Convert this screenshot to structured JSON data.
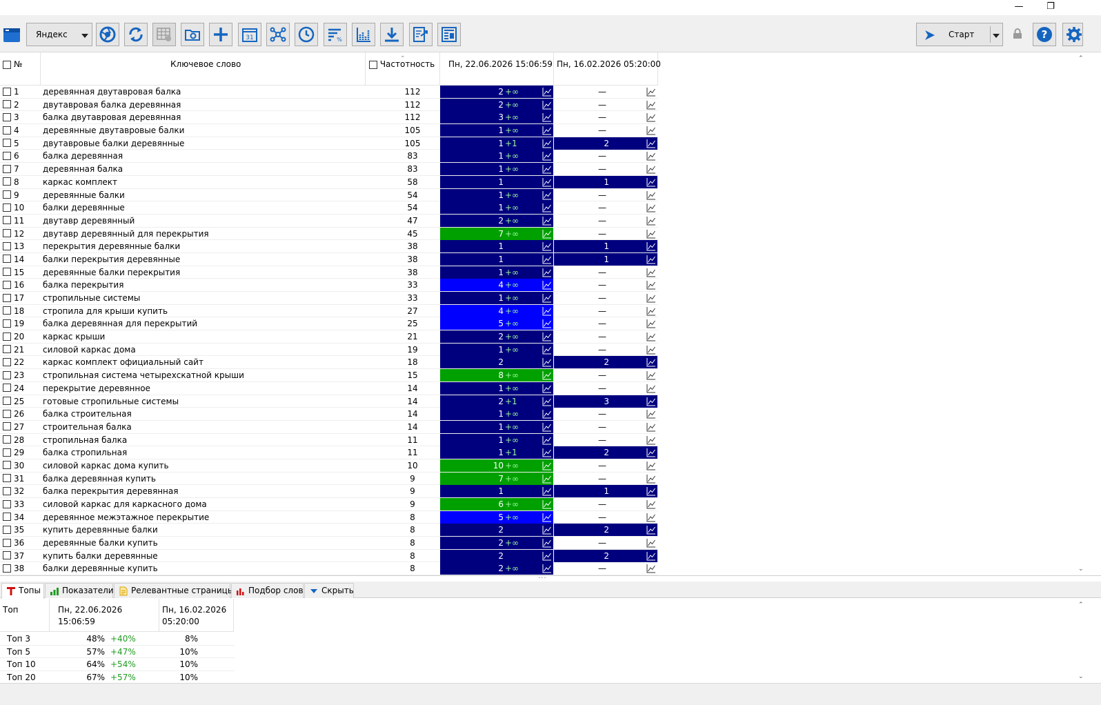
{
  "window": {
    "minimize": "—",
    "restore": "❐"
  },
  "toolbar": {
    "engine": "Яндекс",
    "start_label": "Старт",
    "calendar_day": "31",
    "icons": [
      "app-menu-icon",
      "browser-icon",
      "refresh-icon",
      "table-settings-icon",
      "folder-settings-icon",
      "add-icon",
      "calendar-icon",
      "network-icon",
      "clock-icon",
      "sort-percent-icon",
      "chart-bars-icon",
      "download-icon",
      "export-icon",
      "report-icon",
      "play-icon",
      "lock-icon",
      "help-icon",
      "settings-icon"
    ]
  },
  "grid": {
    "headers": {
      "no": "№",
      "keyword": "Ключевое слово",
      "frequency": "Частотность",
      "date1": "Пн, 22.06.2026 15:06:59",
      "date2": "Пн, 16.02.2026 05:20:00"
    },
    "no_value_mark": "—",
    "colors": {
      "dark": "#00007f",
      "blue": "#0000ff",
      "green": "#00a000",
      "delta": "#9cf89c"
    },
    "rows": [
      {
        "n": "1",
        "kw": "деревянная двутавровая балка",
        "f": "112",
        "p1": "2",
        "d1": "+∞",
        "c1": "dark",
        "p2": null
      },
      {
        "n": "2",
        "kw": "двутавровая балка деревянная",
        "f": "112",
        "p1": "2",
        "d1": "+∞",
        "c1": "dark",
        "p2": null
      },
      {
        "n": "3",
        "kw": "балка двутавровая деревянная",
        "f": "112",
        "p1": "3",
        "d1": "+∞",
        "c1": "dark",
        "p2": null
      },
      {
        "n": "4",
        "kw": "деревянные двутавровые балки",
        "f": "105",
        "p1": "1",
        "d1": "+∞",
        "c1": "dark",
        "p2": null
      },
      {
        "n": "5",
        "kw": "двутавровые балки деревянные",
        "f": "105",
        "p1": "1",
        "d1": "+1",
        "c1": "dark",
        "p2": "2"
      },
      {
        "n": "6",
        "kw": "балка деревянная",
        "f": "83",
        "p1": "1",
        "d1": "+∞",
        "c1": "dark",
        "p2": null
      },
      {
        "n": "7",
        "kw": "деревянная балка",
        "f": "83",
        "p1": "1",
        "d1": "+∞",
        "c1": "dark",
        "p2": null
      },
      {
        "n": "8",
        "kw": "каркас комплект",
        "f": "58",
        "p1": "1",
        "d1": "",
        "c1": "dark",
        "p2": "1"
      },
      {
        "n": "9",
        "kw": "деревянные балки",
        "f": "54",
        "p1": "1",
        "d1": "+∞",
        "c1": "dark",
        "p2": null
      },
      {
        "n": "10",
        "kw": "балки деревянные",
        "f": "54",
        "p1": "1",
        "d1": "+∞",
        "c1": "dark",
        "p2": null
      },
      {
        "n": "11",
        "kw": "двутавр деревянный",
        "f": "47",
        "p1": "2",
        "d1": "+∞",
        "c1": "dark",
        "p2": null
      },
      {
        "n": "12",
        "kw": "двутавр деревянный для перекрытия",
        "f": "45",
        "p1": "7",
        "d1": "+∞",
        "c1": "green",
        "p2": null
      },
      {
        "n": "13",
        "kw": "перекрытия деревянные балки",
        "f": "38",
        "p1": "1",
        "d1": "",
        "c1": "dark",
        "p2": "1"
      },
      {
        "n": "14",
        "kw": "балки перекрытия деревянные",
        "f": "38",
        "p1": "1",
        "d1": "",
        "c1": "dark",
        "p2": "1"
      },
      {
        "n": "15",
        "kw": "деревянные балки перекрытия",
        "f": "38",
        "p1": "1",
        "d1": "+∞",
        "c1": "dark",
        "p2": null
      },
      {
        "n": "16",
        "kw": "балка перекрытия",
        "f": "33",
        "p1": "4",
        "d1": "+∞",
        "c1": "blue",
        "p2": null
      },
      {
        "n": "17",
        "kw": "стропильные системы",
        "f": "33",
        "p1": "1",
        "d1": "+∞",
        "c1": "dark",
        "p2": null
      },
      {
        "n": "18",
        "kw": "стропила для крыши купить",
        "f": "27",
        "p1": "4",
        "d1": "+∞",
        "c1": "blue",
        "p2": null
      },
      {
        "n": "19",
        "kw": "балка деревянная для перекрытий",
        "f": "25",
        "p1": "5",
        "d1": "+∞",
        "c1": "blue",
        "p2": null
      },
      {
        "n": "20",
        "kw": "каркас крыши",
        "f": "21",
        "p1": "2",
        "d1": "+∞",
        "c1": "dark",
        "p2": null
      },
      {
        "n": "21",
        "kw": "силовой каркас дома",
        "f": "19",
        "p1": "1",
        "d1": "+∞",
        "c1": "dark",
        "p2": null
      },
      {
        "n": "22",
        "kw": "каркас комплект официальный сайт",
        "f": "18",
        "p1": "2",
        "d1": "",
        "c1": "dark",
        "p2": "2"
      },
      {
        "n": "23",
        "kw": "стропильная система четырехскатной крыши",
        "f": "15",
        "p1": "8",
        "d1": "+∞",
        "c1": "green",
        "p2": null
      },
      {
        "n": "24",
        "kw": "перекрытие деревянное",
        "f": "14",
        "p1": "1",
        "d1": "+∞",
        "c1": "dark",
        "p2": null
      },
      {
        "n": "25",
        "kw": "готовые стропильные системы",
        "f": "14",
        "p1": "2",
        "d1": "+1",
        "c1": "dark",
        "p2": "3"
      },
      {
        "n": "26",
        "kw": "балка строительная",
        "f": "14",
        "p1": "1",
        "d1": "+∞",
        "c1": "dark",
        "p2": null
      },
      {
        "n": "27",
        "kw": "строительная балка",
        "f": "14",
        "p1": "1",
        "d1": "+∞",
        "c1": "dark",
        "p2": null
      },
      {
        "n": "28",
        "kw": "стропильная балка",
        "f": "11",
        "p1": "1",
        "d1": "+∞",
        "c1": "dark",
        "p2": null
      },
      {
        "n": "29",
        "kw": "балка стропильная",
        "f": "11",
        "p1": "1",
        "d1": "+1",
        "c1": "dark",
        "p2": "2"
      },
      {
        "n": "30",
        "kw": "силовой каркас дома купить",
        "f": "10",
        "p1": "10",
        "d1": "+∞",
        "c1": "green",
        "p2": null
      },
      {
        "n": "31",
        "kw": "балка деревянная купить",
        "f": "9",
        "p1": "7",
        "d1": "+∞",
        "c1": "green",
        "p2": null
      },
      {
        "n": "32",
        "kw": "балка перекрытия деревянная",
        "f": "9",
        "p1": "1",
        "d1": "",
        "c1": "dark",
        "p2": "1"
      },
      {
        "n": "33",
        "kw": "силовой каркас для каркасного дома",
        "f": "9",
        "p1": "6",
        "d1": "+∞",
        "c1": "green",
        "p2": null
      },
      {
        "n": "34",
        "kw": "деревянное межэтажное перекрытие",
        "f": "8",
        "p1": "5",
        "d1": "+∞",
        "c1": "blue",
        "p2": null
      },
      {
        "n": "35",
        "kw": "купить деревянные балки",
        "f": "8",
        "p1": "2",
        "d1": "",
        "c1": "dark",
        "p2": "2"
      },
      {
        "n": "36",
        "kw": "деревянные балки купить",
        "f": "8",
        "p1": "2",
        "d1": "+∞",
        "c1": "dark",
        "p2": null
      },
      {
        "n": "37",
        "kw": "купить балки деревянные",
        "f": "8",
        "p1": "2",
        "d1": "",
        "c1": "dark",
        "p2": "2"
      },
      {
        "n": "38",
        "kw": "балки деревянные купить",
        "f": "8",
        "p1": "2",
        "d1": "+∞",
        "c1": "dark",
        "p2": null
      }
    ]
  },
  "tabs": [
    {
      "label": "Топы",
      "icon": "tops-icon",
      "active": true
    },
    {
      "label": "Показатели",
      "icon": "indicators-icon",
      "active": false
    },
    {
      "label": "Релевантные страницы",
      "icon": "pages-icon",
      "active": false
    },
    {
      "label": "Подбор слов",
      "icon": "word-selection-icon",
      "active": false
    },
    {
      "label": "Скрыть",
      "icon": "hide-icon",
      "active": false
    }
  ],
  "tops": {
    "header": {
      "label": "Топ",
      "date1": "Пн, 22.06.2026 15:06:59",
      "date2_line1": "Пн, 16.02.2026",
      "date2_line2": "05:20:00"
    },
    "rows": [
      {
        "label": "Топ 3",
        "v1": "48%",
        "d1": "+40%",
        "v2": "8%"
      },
      {
        "label": "Топ 5",
        "v1": "57%",
        "d1": "+47%",
        "v2": "10%"
      },
      {
        "label": "Топ 10",
        "v1": "64%",
        "d1": "+54%",
        "v2": "10%"
      },
      {
        "label": "Топ 20",
        "v1": "67%",
        "d1": "+57%",
        "v2": "10%"
      }
    ]
  }
}
